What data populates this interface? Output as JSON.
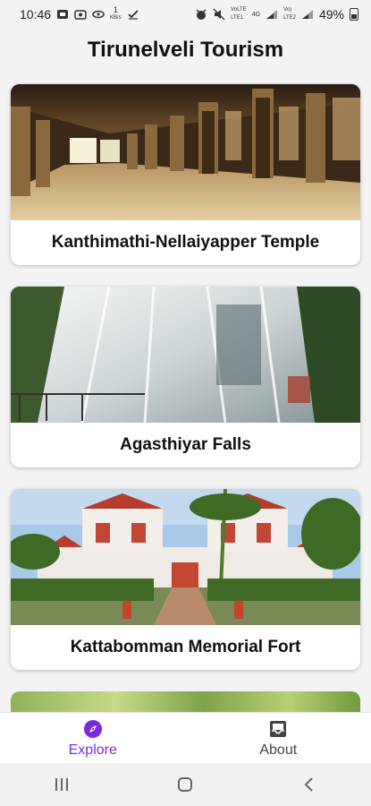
{
  "status": {
    "time": "10:46",
    "data_rate_num": "1",
    "data_rate_unit": "KB/s",
    "net1_top": "VoLTE",
    "net1_bot": "LTE1",
    "net2_top": "4G",
    "net2_bot": "",
    "net3_top": "Vo)",
    "net3_bot": "LTE2",
    "battery": "49%"
  },
  "app": {
    "title": "Tirunelveli Tourism"
  },
  "places": [
    {
      "name": "Kanthimathi-Nellaiyapper Temple"
    },
    {
      "name": "Agasthiyar Falls"
    },
    {
      "name": "Kattabomman Memorial Fort"
    }
  ],
  "nav": {
    "explore_label": "Explore",
    "about_label": "About",
    "active_color": "#7a2be2"
  }
}
